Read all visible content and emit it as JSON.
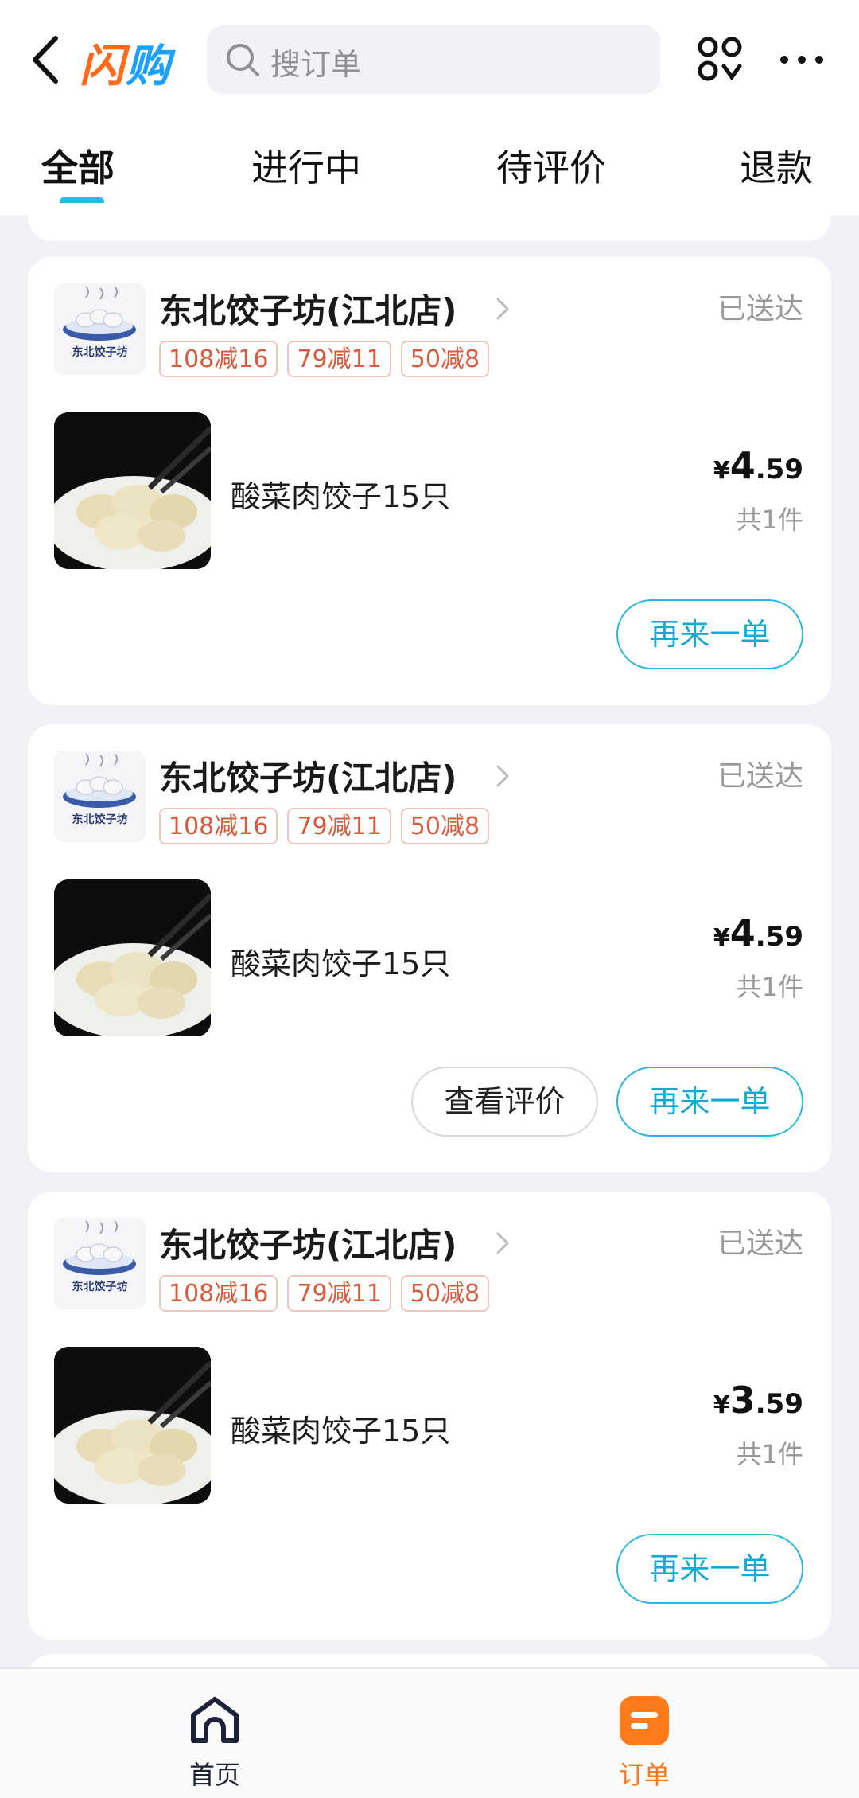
{
  "header": {
    "brand": "闪购",
    "search_placeholder": "搜订单"
  },
  "tabs": [
    {
      "label": "全部",
      "active": true
    },
    {
      "label": "进行中",
      "active": false
    },
    {
      "label": "待评价",
      "active": false
    },
    {
      "label": "退款",
      "active": false
    }
  ],
  "orders": [
    {
      "shop_name": "东北饺子坊(江北店)",
      "logo_text": "东北饺子坊",
      "status": "已送达",
      "tags": [
        "108减16",
        "79减11",
        "50减8"
      ],
      "item_name": "酸菜肉饺子15只",
      "price_symbol": "¥",
      "price_int": "4",
      "price_dec": ".59",
      "qty": "共1件",
      "buttons": [
        "再来一单"
      ]
    },
    {
      "shop_name": "东北饺子坊(江北店)",
      "logo_text": "东北饺子坊",
      "status": "已送达",
      "tags": [
        "108减16",
        "79减11",
        "50减8"
      ],
      "item_name": "酸菜肉饺子15只",
      "price_symbol": "¥",
      "price_int": "4",
      "price_dec": ".59",
      "qty": "共1件",
      "buttons": [
        "查看评价",
        "再来一单"
      ]
    },
    {
      "shop_name": "东北饺子坊(江北店)",
      "logo_text": "东北饺子坊",
      "status": "已送达",
      "tags": [
        "108减16",
        "79减11",
        "50减8"
      ],
      "item_name": "酸菜肉饺子15只",
      "price_symbol": "¥",
      "price_int": "3",
      "price_dec": ".59",
      "qty": "共1件",
      "buttons": [
        "再来一单"
      ]
    }
  ],
  "bottom_nav": [
    {
      "label": "首页",
      "icon": "home-icon",
      "active": false
    },
    {
      "label": "订单",
      "icon": "order-icon",
      "active": true
    }
  ],
  "colors": {
    "accent": "#1ec2e8",
    "button_text": "#12a9d3",
    "tag_red": "#d85b3d",
    "brand_orange": "#ff6a1a",
    "brand_blue": "#1aa0ff",
    "nav_active": "#ff7a1a"
  }
}
